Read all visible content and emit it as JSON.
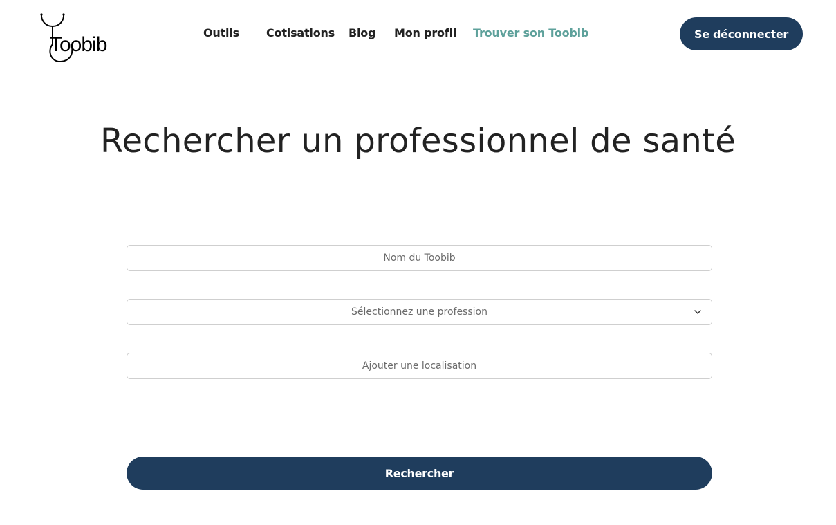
{
  "brand": {
    "name": "Toobib"
  },
  "nav": {
    "items": [
      {
        "label": "Outils",
        "active": false
      },
      {
        "label": "Cotisations",
        "active": false
      },
      {
        "label": "Blog",
        "active": false
      },
      {
        "label": "Mon profil",
        "active": false
      },
      {
        "label": "Trouver son Toobib",
        "active": true
      }
    ],
    "logout_label": "Se déconnecter"
  },
  "main": {
    "title": "Rechercher un professionnel de santé",
    "name_field": {
      "placeholder": "Nom du Toobib",
      "value": ""
    },
    "profession_select": {
      "selected": "Sélectionnez une profession"
    },
    "location_field": {
      "placeholder": "Ajouter une localisation",
      "value": ""
    },
    "search_button_label": "Rechercher"
  },
  "colors": {
    "primary": "#1f3d5d",
    "active_nav": "#5ea19b",
    "text": "#222222"
  }
}
